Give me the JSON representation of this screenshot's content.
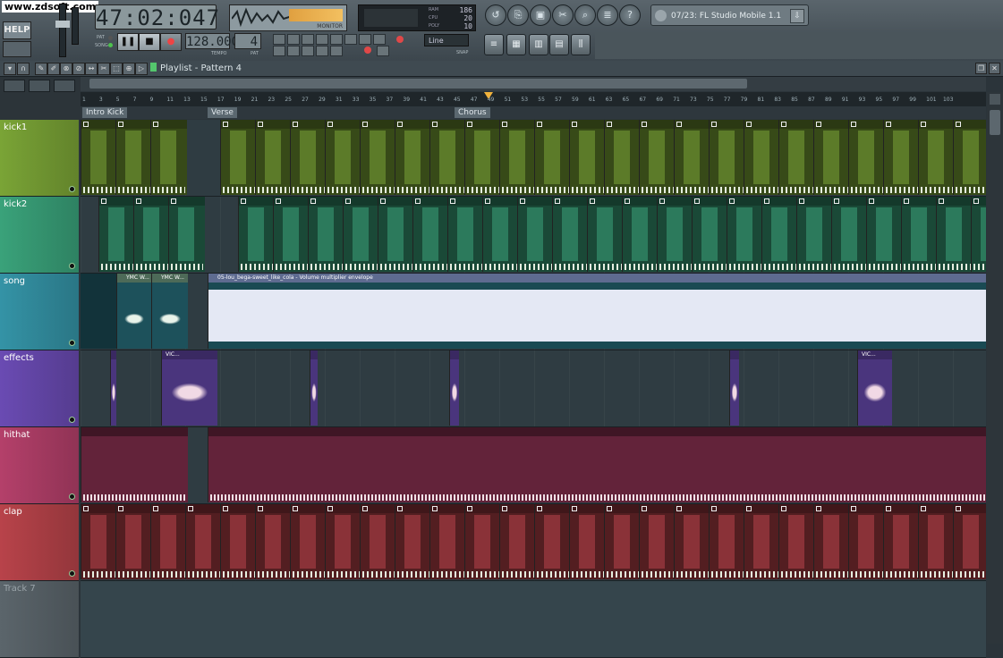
{
  "watermark": "www.zdsoft.com",
  "top": {
    "help_label": "HELP",
    "time_display": "47:02:047",
    "monitor_label": "MONITOR",
    "cpu_values": [
      "186",
      "20",
      "10"
    ],
    "cpu_labels": [
      "RAM",
      "CPU",
      "POLY"
    ],
    "tempo_value": "128.000",
    "tempo_label": "TEMPO",
    "pattern_value": "4",
    "pattern_label": "PAT",
    "mode_labels": [
      "PAT",
      "SONG"
    ],
    "snap_value": "Line",
    "snap_label": "SNAP",
    "plugin_name": "07/23: FL Studio Mobile 1.1"
  },
  "playlist": {
    "title": "Playlist - Pattern 4",
    "ruler_numbers": [
      "1",
      "3",
      "5",
      "7",
      "9",
      "11",
      "13",
      "15",
      "17",
      "19",
      "21",
      "23",
      "25",
      "27",
      "29",
      "31",
      "33",
      "35",
      "37",
      "39",
      "41",
      "43",
      "45",
      "47",
      "49",
      "51",
      "53",
      "55",
      "57",
      "59",
      "61",
      "63",
      "65",
      "67",
      "69",
      "71",
      "73",
      "75",
      "77",
      "79",
      "81",
      "83",
      "85",
      "87",
      "89",
      "91",
      "93",
      "95",
      "97",
      "99",
      "101",
      "103"
    ],
    "markers": [
      {
        "label": "Intro Kick"
      },
      {
        "label": "Verse"
      },
      {
        "label": "Chorus"
      }
    ],
    "tracks": [
      {
        "name": "kick1",
        "color": "#7aa436"
      },
      {
        "name": "kick2",
        "color": "#3aa27a"
      },
      {
        "name": "song",
        "color": "#3493a6"
      },
      {
        "name": "effects",
        "color": "#6a4bb3"
      },
      {
        "name": "hithat",
        "color": "#b4406a"
      },
      {
        "name": "clap",
        "color": "#b8434a"
      },
      {
        "name": "Track 7",
        "color": "#5b656b"
      }
    ],
    "song_clip_labels": [
      "YMC W...",
      "YMC W...",
      "05-lou_bega-sweet_like_cola - Volume multiplier envelope"
    ],
    "effects_clip_labels": [
      "VIC...",
      "VIC..."
    ]
  }
}
